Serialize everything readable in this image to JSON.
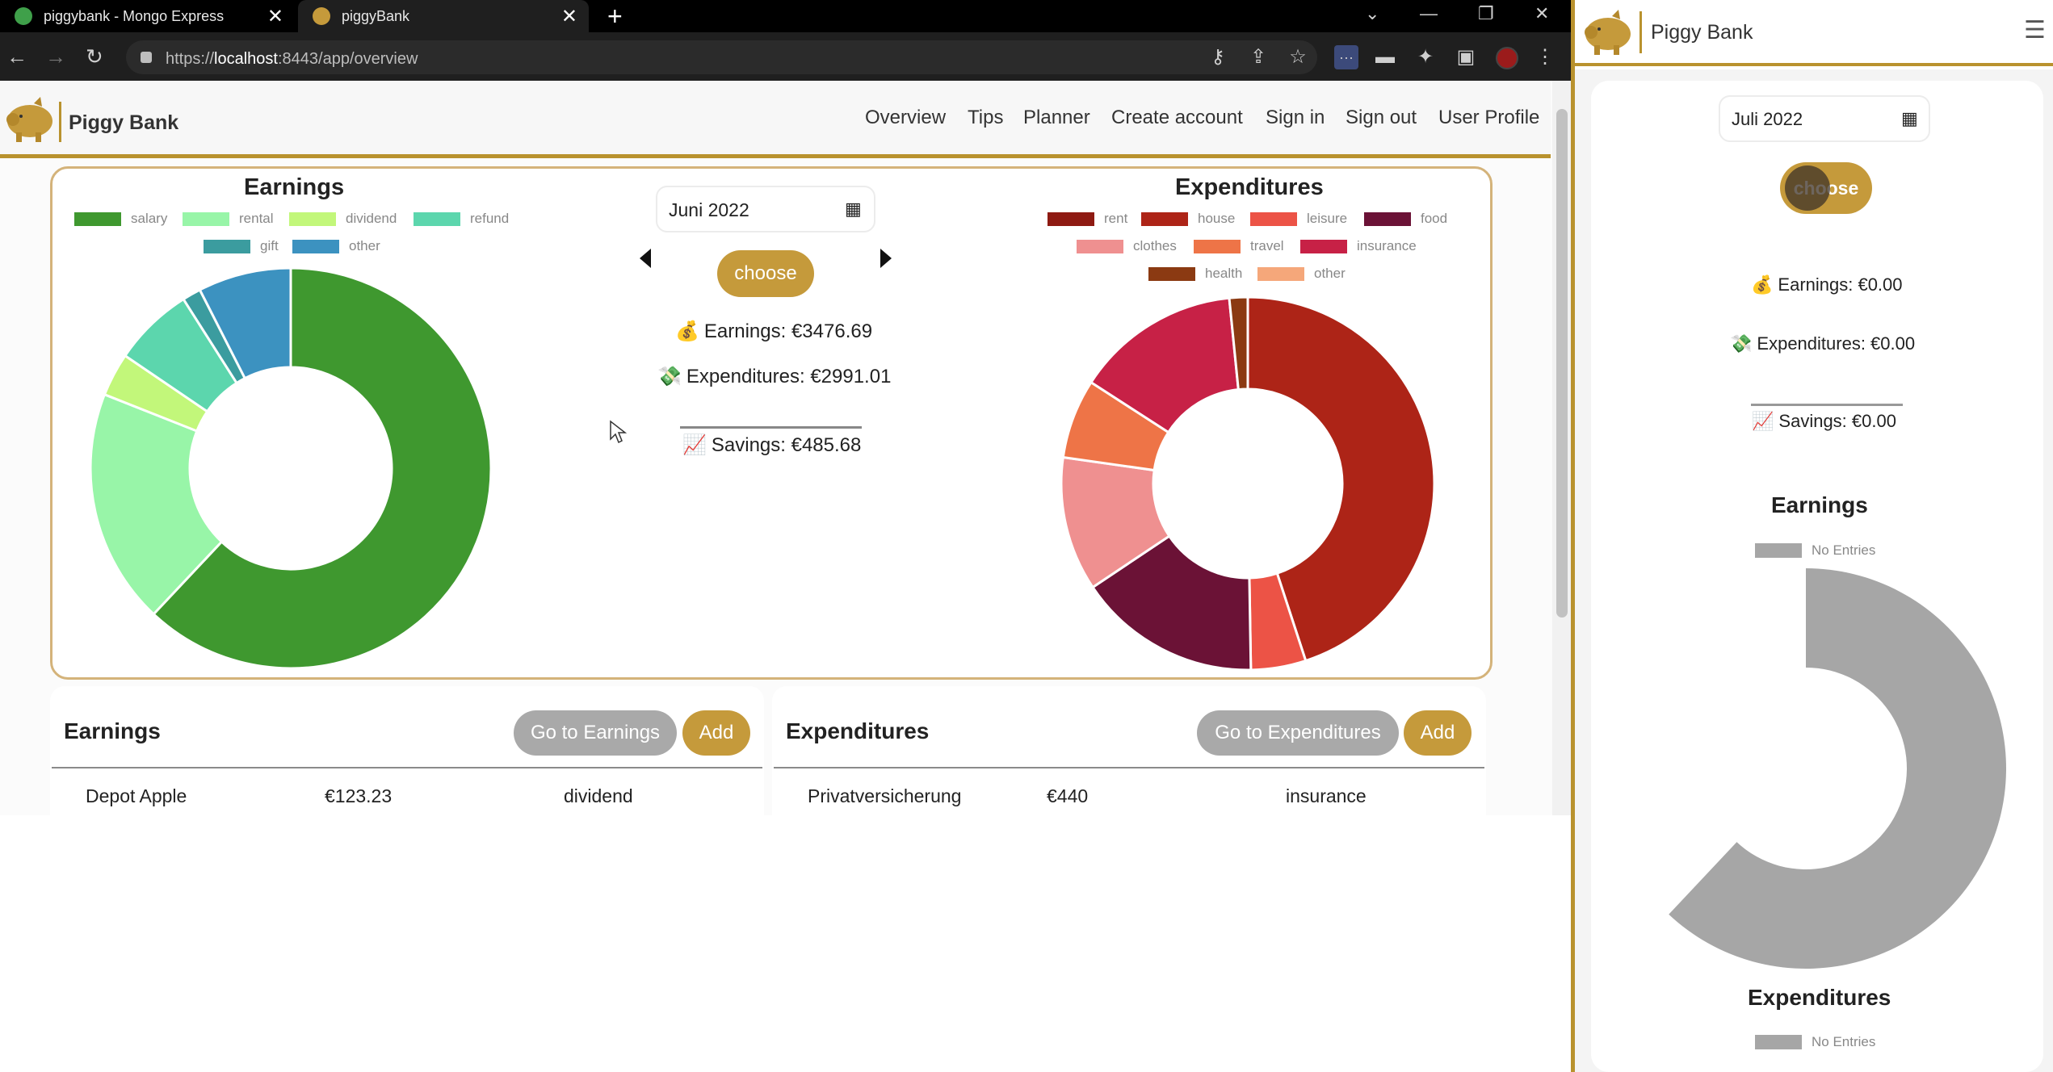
{
  "browser": {
    "tabs": [
      {
        "title": "piggybank - Mongo Express",
        "active": false
      },
      {
        "title": "piggyBank",
        "active": true
      }
    ],
    "url_prefix": "https://",
    "url_host": "localhost",
    "url_rest": ":8443/app/overview"
  },
  "app": {
    "brand": "Piggy Bank",
    "nav": [
      "Overview",
      "Tips",
      "Planner",
      "Create account",
      "Sign in",
      "Sign out",
      "User Profile"
    ],
    "accent": "#c59a3b"
  },
  "overview": {
    "earnings_title": "Earnings",
    "expenditures_title": "Expenditures",
    "month": "Juni 2022",
    "choose_label": "choose",
    "earnings_line": "Earnings: €3476.69",
    "expenditures_line": "Expenditures: €2991.01",
    "savings_line": "Savings: €485.68",
    "earnings_legend": [
      {
        "label": "salary",
        "color": "#3f982f"
      },
      {
        "label": "rental",
        "color": "#98f5a8"
      },
      {
        "label": "dividend",
        "color": "#c2f77a"
      },
      {
        "label": "refund",
        "color": "#5cd6ad"
      },
      {
        "label": "gift",
        "color": "#3b9c9f"
      },
      {
        "label": "other",
        "color": "#3c92c0"
      }
    ],
    "expenditures_legend": [
      {
        "label": "rent",
        "color": "#8e1a12"
      },
      {
        "label": "house",
        "color": "#ad2417"
      },
      {
        "label": "leisure",
        "color": "#ec5346"
      },
      {
        "label": "food",
        "color": "#6b1236"
      },
      {
        "label": "clothes",
        "color": "#ef9090"
      },
      {
        "label": "travel",
        "color": "#ee7447"
      },
      {
        "label": "insurance",
        "color": "#c72146"
      },
      {
        "label": "health",
        "color": "#8b3a12"
      },
      {
        "label": "other",
        "color": "#f5a77a"
      }
    ]
  },
  "chart_data": [
    {
      "type": "pie",
      "title": "Earnings",
      "categories": [
        "salary",
        "rental",
        "dividend",
        "refund",
        "gift",
        "other"
      ],
      "values": [
        62,
        19,
        3.5,
        6.5,
        1.5,
        7.5
      ]
    },
    {
      "type": "pie",
      "title": "Expenditures",
      "categories": [
        "rent",
        "house",
        "leisure",
        "food",
        "clothes",
        "travel",
        "insurance",
        "health",
        "other"
      ],
      "values": [
        0,
        42.5,
        4.5,
        15,
        11,
        6.5,
        13.5,
        1.5,
        0
      ]
    },
    {
      "type": "pie",
      "title": "Earnings",
      "categories": [
        "No Entries"
      ],
      "values": [
        1
      ]
    }
  ],
  "earnings_panel": {
    "title": "Earnings",
    "goto_label": "Go to Earnings",
    "add_label": "Add",
    "rows": [
      {
        "name": "Depot Apple",
        "amount": "€123.23",
        "category": "dividend"
      }
    ]
  },
  "expenditures_panel": {
    "title": "Expenditures",
    "goto_label": "Go to Expenditures",
    "add_label": "Add",
    "rows": [
      {
        "name": "Privatversicherung",
        "amount": "€440",
        "category": "insurance"
      }
    ]
  },
  "mobile": {
    "brand": "Piggy Bank",
    "month": "Juli 2022",
    "choose_label": "choose",
    "earnings_line": "Earnings: €0.00",
    "expenditures_line": "Expenditures: €0.00",
    "savings_line": "Savings: €0.00",
    "earnings_title": "Earnings",
    "expenditures_title": "Expenditures",
    "no_entries": "No Entries",
    "no_entries_color": "#a6a6a6"
  }
}
